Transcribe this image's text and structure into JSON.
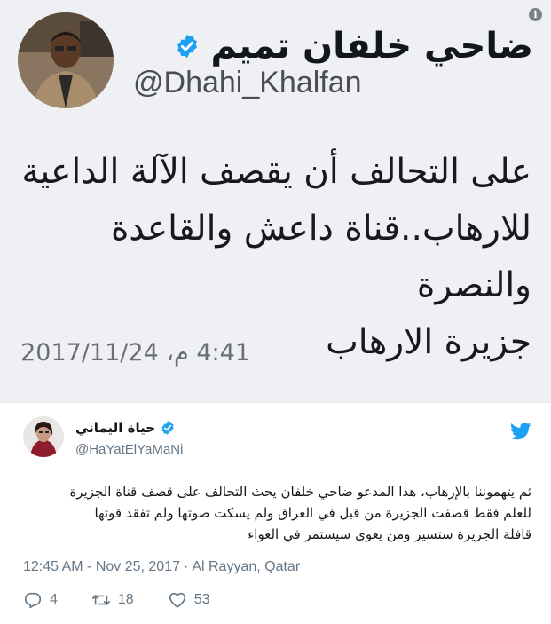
{
  "quoted": {
    "name": "ضاحي خلفان تميم",
    "handle": "@Dhahi_Khalfan",
    "text_lines": [
      "على التحالف أن يقصف الآلة الداعية",
      "للارهاب..قناة داعش والقاعدة والنصرة",
      "جزيرة الارهاب"
    ],
    "timestamp": "4:41 م، 2017/11/24"
  },
  "tweet": {
    "author_name": "حياة اليماني",
    "author_handle": "@HaYatElYaMaNi",
    "text_lines": [
      "ثم يتهموننا بالإرهاب، هذا المدعو ضاحي خلفان يحث التحالف على قصف قناة الجزيرة",
      "للعلم فقط قصفت الجزيرة من قبل في العراق ولم يسكت صوتها ولم تفقد قوتها",
      "قافلة الجزيرة ستسير ومن يعوى سيستمر في العواء"
    ],
    "time": "12:45 AM - Nov 25, 2017",
    "separator": "·",
    "location": "Al Rayyan, Qatar",
    "reply_count": "4",
    "retweet_count": "18",
    "like_count": "53"
  },
  "icons": {
    "info": "info-icon",
    "verified": "verified-badge-icon",
    "twitter": "twitter-bird-icon",
    "reply": "reply-icon",
    "retweet": "retweet-icon",
    "like": "heart-icon"
  },
  "colors": {
    "twitter_blue": "#1da1f2",
    "muted_text": "#657786",
    "quoted_background": "#eef0f3"
  }
}
